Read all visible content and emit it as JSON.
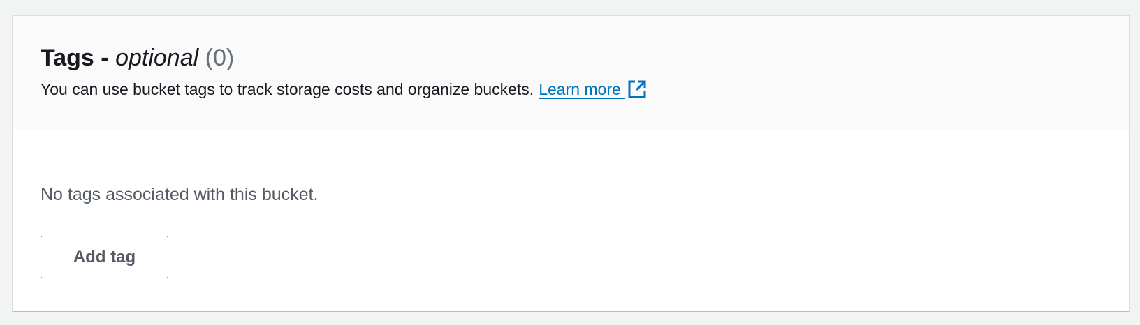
{
  "section": {
    "title": "Tags",
    "title_separator": "-",
    "title_optional": "optional",
    "count": "(0)",
    "description": "You can use bucket tags to track storage costs and organize buckets.",
    "learn_more_label": "Learn more",
    "learn_more_icon": "external-link-icon"
  },
  "body": {
    "empty_message": "No tags associated with this bucket.",
    "add_tag_label": "Add tag"
  },
  "colors": {
    "link": "#0073bb",
    "title_text": "#16191f",
    "muted_text": "#545b64",
    "count_text": "#687078",
    "header_bg": "#fafafa",
    "page_bg": "#f2f3f3"
  }
}
